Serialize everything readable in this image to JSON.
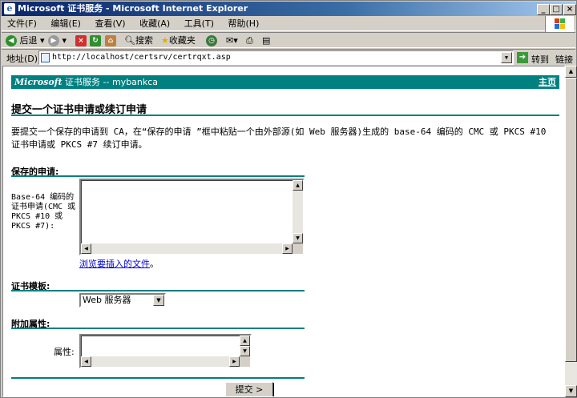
{
  "window": {
    "title": "Microsoft 证书服务 - Microsoft Internet Explorer",
    "min": "_",
    "max": "□",
    "close": "×"
  },
  "menu": [
    "文件(F)",
    "编辑(E)",
    "查看(V)",
    "收藏(A)",
    "工具(T)",
    "帮助(H)"
  ],
  "toolbar": {
    "back": "后退",
    "search": "搜索",
    "favorites": "收藏夹"
  },
  "address": {
    "label": "地址(D)",
    "url": "http://localhost/certsrv/certrqxt.asp",
    "go": "转到",
    "links": "链接"
  },
  "page": {
    "header_brand": "Microsoft",
    "header_text": "证书服务 --  mybankca",
    "home_link": "主页",
    "title": "提交一个证书申请或续订申请",
    "intro": "要提交一个保存的申请到 CA，在“保存的申请 ”框中粘贴一个由外部源(如 Web 服务器)生成的 base-64 编码的 CMC 或 PKCS #10 证书申请或 PKCS #7 续订申请。",
    "saved_request_heading": "保存的申请:",
    "saved_request_label": "Base-64 编码的证书申请(CMC 或 PKCS #10 或 PKCS #7):",
    "browse_link": "浏览要插入的文件",
    "browse_suffix": "。",
    "template_heading": "证书模板:",
    "template_value": "Web 服务器",
    "attributes_heading": "附加属性:",
    "attributes_label": "属性:",
    "submit_label": "提交 >"
  },
  "colors": {
    "accent": "#008080",
    "titlebar": "#0a246a",
    "chrome": "#d4d0c8"
  }
}
